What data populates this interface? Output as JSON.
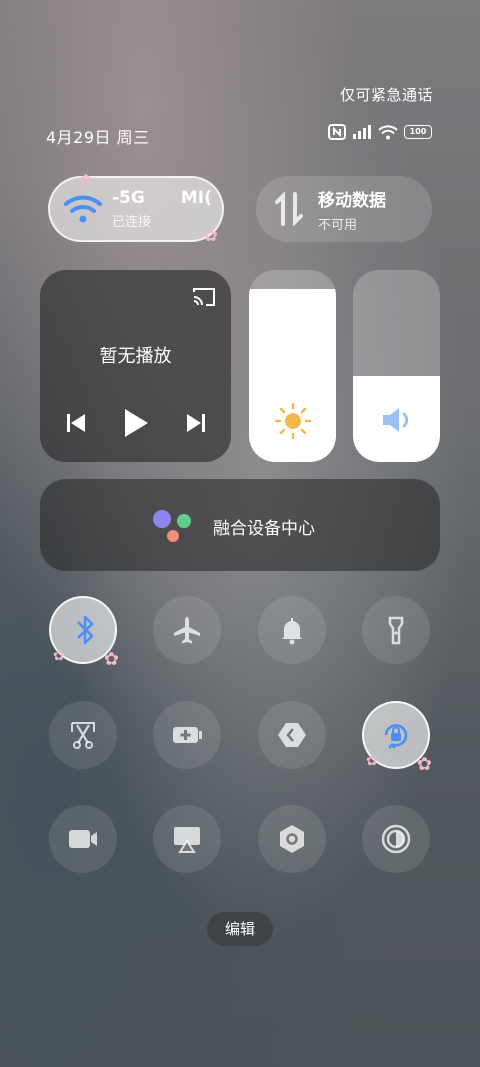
{
  "status": {
    "emergency_text": "仅可紧急通话",
    "date_text": "4月29日 周三",
    "battery_text": "100",
    "icons": [
      "nfc-icon",
      "signal-icon",
      "wifi-icon",
      "battery-icon"
    ]
  },
  "wifi": {
    "name": "-5G",
    "name_trail": "MI(",
    "status": "已连接"
  },
  "mobile_data": {
    "title": "移动数据",
    "status": "不可用"
  },
  "media": {
    "title": "暂无播放"
  },
  "brightness": {
    "level": 0.9
  },
  "volume": {
    "level": 0.45
  },
  "fusion": {
    "label": "融合设备中心"
  },
  "toggles": [
    {
      "name": "bluetooth",
      "icon": "bluetooth-icon",
      "on": true
    },
    {
      "name": "airplane",
      "icon": "airplane-icon",
      "on": false
    },
    {
      "name": "ringer",
      "icon": "bell-icon",
      "on": false
    },
    {
      "name": "flashlight",
      "icon": "flashlight-icon",
      "on": false
    },
    {
      "name": "screenshot",
      "icon": "scissors-icon",
      "on": false
    },
    {
      "name": "battery-saver",
      "icon": "battery-plus-icon",
      "on": false
    },
    {
      "name": "code-scanner",
      "icon": "diamond-icon",
      "on": false
    },
    {
      "name": "rotation-lock",
      "icon": "rotation-lock-icon",
      "on": true
    },
    {
      "name": "screen-record",
      "icon": "camera-icon",
      "on": false
    },
    {
      "name": "screen-cast",
      "icon": "cast-icon",
      "on": false
    },
    {
      "name": "settings-hex",
      "icon": "hexagon-icon",
      "on": false
    },
    {
      "name": "dark-mode",
      "icon": "contrast-icon",
      "on": false
    }
  ],
  "edit": {
    "label": "编辑"
  }
}
